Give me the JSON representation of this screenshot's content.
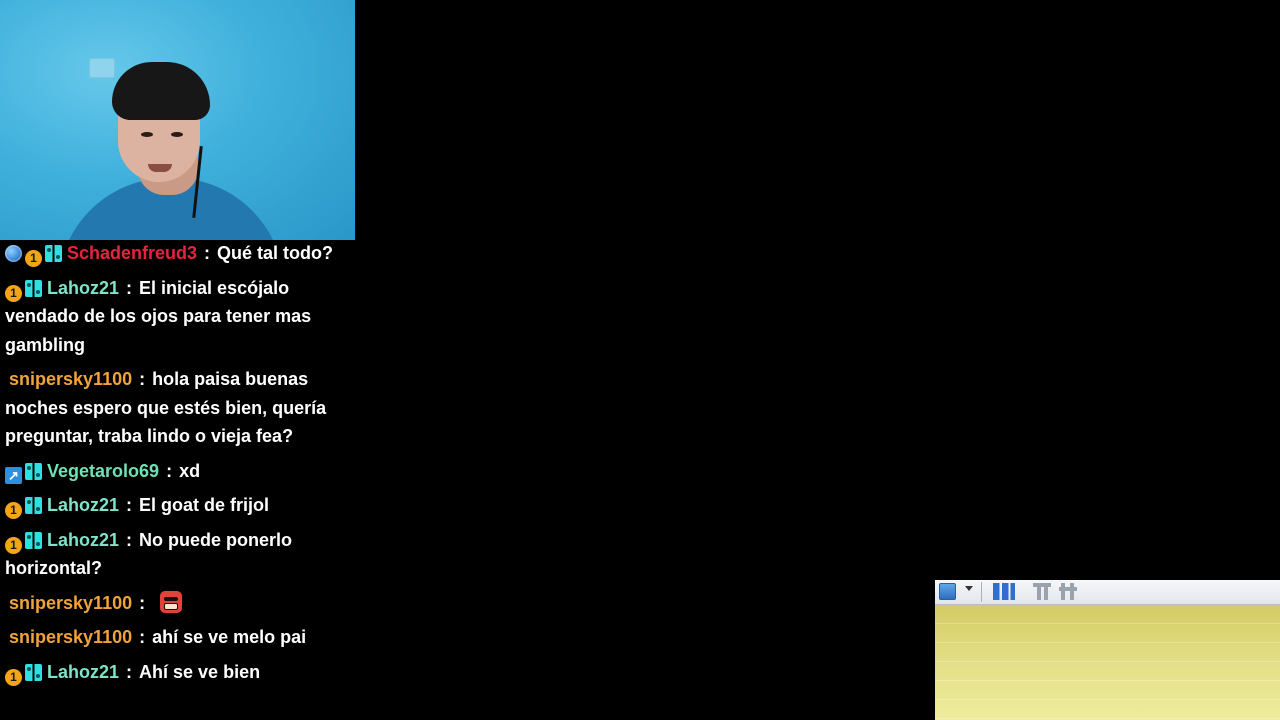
{
  "colors": {
    "background": "#000000",
    "chat_text": "#ffffff",
    "user_schadenfreud3": "#e8233e",
    "user_lahoz21": "#7ee3c9",
    "user_snipersky1100": "#f0a23b",
    "user_vegetarolo69": "#6fe2b7"
  },
  "chat": {
    "messages": [
      {
        "badges": [
          "globe-badge",
          "tier-one-badge",
          "switch-badge"
        ],
        "user": "Schadenfreud3",
        "sep": ":",
        "text": "Qué tal todo?"
      },
      {
        "badges": [
          "tier-one-badge",
          "switch-badge"
        ],
        "user": "Lahoz21",
        "sep": ":",
        "text": "El inicial escójalo vendado de los ojos para tener mas gambling"
      },
      {
        "badges": [],
        "user": "snipersky1100",
        "sep": ":",
        "text": "hola paisa buenas noches espero que estés bien, quería preguntar, traba lindo o vieja fea?"
      },
      {
        "badges": [
          "arrow-badge",
          "switch-badge"
        ],
        "user": "Vegetarolo69",
        "sep": ":",
        "text": "xd"
      },
      {
        "badges": [
          "tier-one-badge",
          "switch-badge"
        ],
        "user": "Lahoz21",
        "sep": ":",
        "text": "El goat de frijol"
      },
      {
        "badges": [
          "tier-one-badge",
          "switch-badge"
        ],
        "user": "Lahoz21",
        "sep": ":",
        "text": "No puede ponerlo horizontal?"
      },
      {
        "badges": [],
        "user": "snipersky1100",
        "sep": ":",
        "text": "",
        "emote": "angry-face-emote"
      },
      {
        "badges": [],
        "user": "snipersky1100",
        "sep": ":",
        "text": "ahí se ve melo pai"
      },
      {
        "badges": [
          "tier-one-badge",
          "switch-badge"
        ],
        "user": "Lahoz21",
        "sep": ":",
        "text": "Ahí se ve bien"
      }
    ]
  },
  "app_window": {
    "toolbar_icons": [
      "window-icon",
      "chevron-down-icon",
      "columns-icon",
      "merge-cells-icon",
      "split-cells-icon"
    ]
  }
}
